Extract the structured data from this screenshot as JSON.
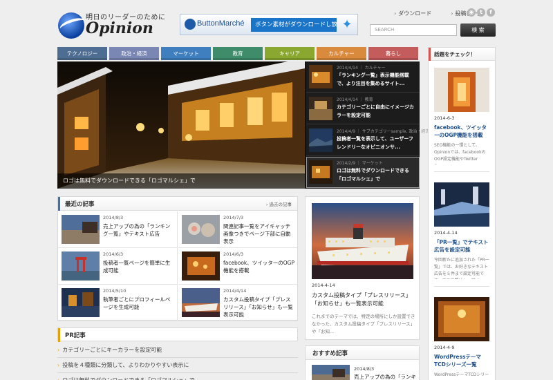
{
  "header": {
    "tagline": "明日のリーダーのために",
    "site_name": "Opinion",
    "banner": {
      "brand": "ButtonMarché",
      "text": "ボタン素材がダウンロードし放題！"
    },
    "links": [
      "ダウンロード",
      "投稿者一覧"
    ],
    "social": [
      "rss-icon",
      "twitter-icon",
      "facebook-icon"
    ],
    "search": {
      "placeholder": "SEARCH",
      "button": "検 索"
    }
  },
  "nav": {
    "items": [
      {
        "label": "テクノロジー",
        "color": "#4e6d92"
      },
      {
        "label": "政治・経済",
        "color": "#7a86b3"
      },
      {
        "label": "マーケット",
        "color": "#3f7fbf"
      },
      {
        "label": "教育",
        "color": "#3f8c6a"
      },
      {
        "label": "キャリア",
        "color": "#8aa82f"
      },
      {
        "label": "カルチャー",
        "color": "#d98a3d"
      },
      {
        "label": "暮らし",
        "color": "#c45c5c"
      }
    ]
  },
  "slider": {
    "caption": "ロゴは無料でダウンロードできる「ロゴマルシェ」で",
    "items": [
      {
        "meta": "2014/4/14 ｜ カルチャー",
        "title": "「ランキング一覧」表示機能搭載で、より注目を集めるサイト..."
      },
      {
        "meta": "2014/4/14 ｜ 教育",
        "title": "カテゴリーごとに自由にイメージカラーを設定可能"
      },
      {
        "meta": "2014/4/9 ｜ サブカテゴリーsample, 政治・経済",
        "title": "投稿者一覧を表示して、ユーザーフレンドリーなオピニオンサ..."
      },
      {
        "meta": "2014/2/9 ｜ マーケット",
        "title": "ロゴは無料でダウンロードできる「ロゴマルシェ」で"
      }
    ]
  },
  "recent": {
    "title": "最近の記事",
    "link": "過去の記事",
    "accent": "#4e6d92",
    "items": [
      {
        "date": "2014/8/3",
        "title": "売上アップの為の「ランキング一覧」やテキスト広告"
      },
      {
        "date": "2014/7/3",
        "title": "関連記事一覧をアイキャッチ画像つきでページ下部に自動表示"
      },
      {
        "date": "2014/6/3",
        "title": "投稿者一覧ページを簡単に生成可能"
      },
      {
        "date": "2014/6/3",
        "title": "facebook、ツイッターのOGP機能を搭載"
      },
      {
        "date": "2014/5/10",
        "title": "執筆者ごとにプロフィールページを生成可能"
      },
      {
        "date": "2014/4/14",
        "title": "カスタム投稿タイプ「プレスリリース」「お知らせ」も一覧表示可能"
      }
    ]
  },
  "pr": {
    "title": "PR記事",
    "accent": "#e6a100",
    "items": [
      "カテゴリーごとにキーカラーを設定可能",
      "投稿を４種類に分類して、よりわかりやすい表示に",
      "ロゴは無料でダウンロードできる「ロゴマルシェ」で"
    ]
  },
  "featured": {
    "date": "2014-4-14",
    "title": "カスタム投稿タイプ「プレスリリース」「お知らせ」も一覧表示可能",
    "desc": "これまでのテーマでは、特定の場所にしか設置できなかった、カスタム投稿タイプ「プレスリリース」や「お知..."
  },
  "recommend": {
    "title": "おすすめ記事",
    "date": "2014/8/3",
    "item_title": "売上アップの為の「ランキ"
  },
  "right": {
    "title": "話題をチェック！",
    "accent": "#d9534f",
    "items": [
      {
        "date": "2014-6-3",
        "title": "facebook、ツイッターのOGP機能を搭載",
        "desc": "SEO機能の一環として、Opinionでは、facebookのOGP設定機能やTwitter Car..."
      },
      {
        "date": "2014-4-14",
        "title": "「PR一覧」でテキスト広告を設定可能",
        "desc": "今回新たに追加された「PR一覧」では、お好きなテキスト広告を５件まで設定可能です。表示位置はトップペ..."
      },
      {
        "date": "2014-4-9",
        "title": "WordPressテーマTCDシリーズ一覧",
        "desc": "WordPressテーマTCDシリー"
      }
    ]
  }
}
